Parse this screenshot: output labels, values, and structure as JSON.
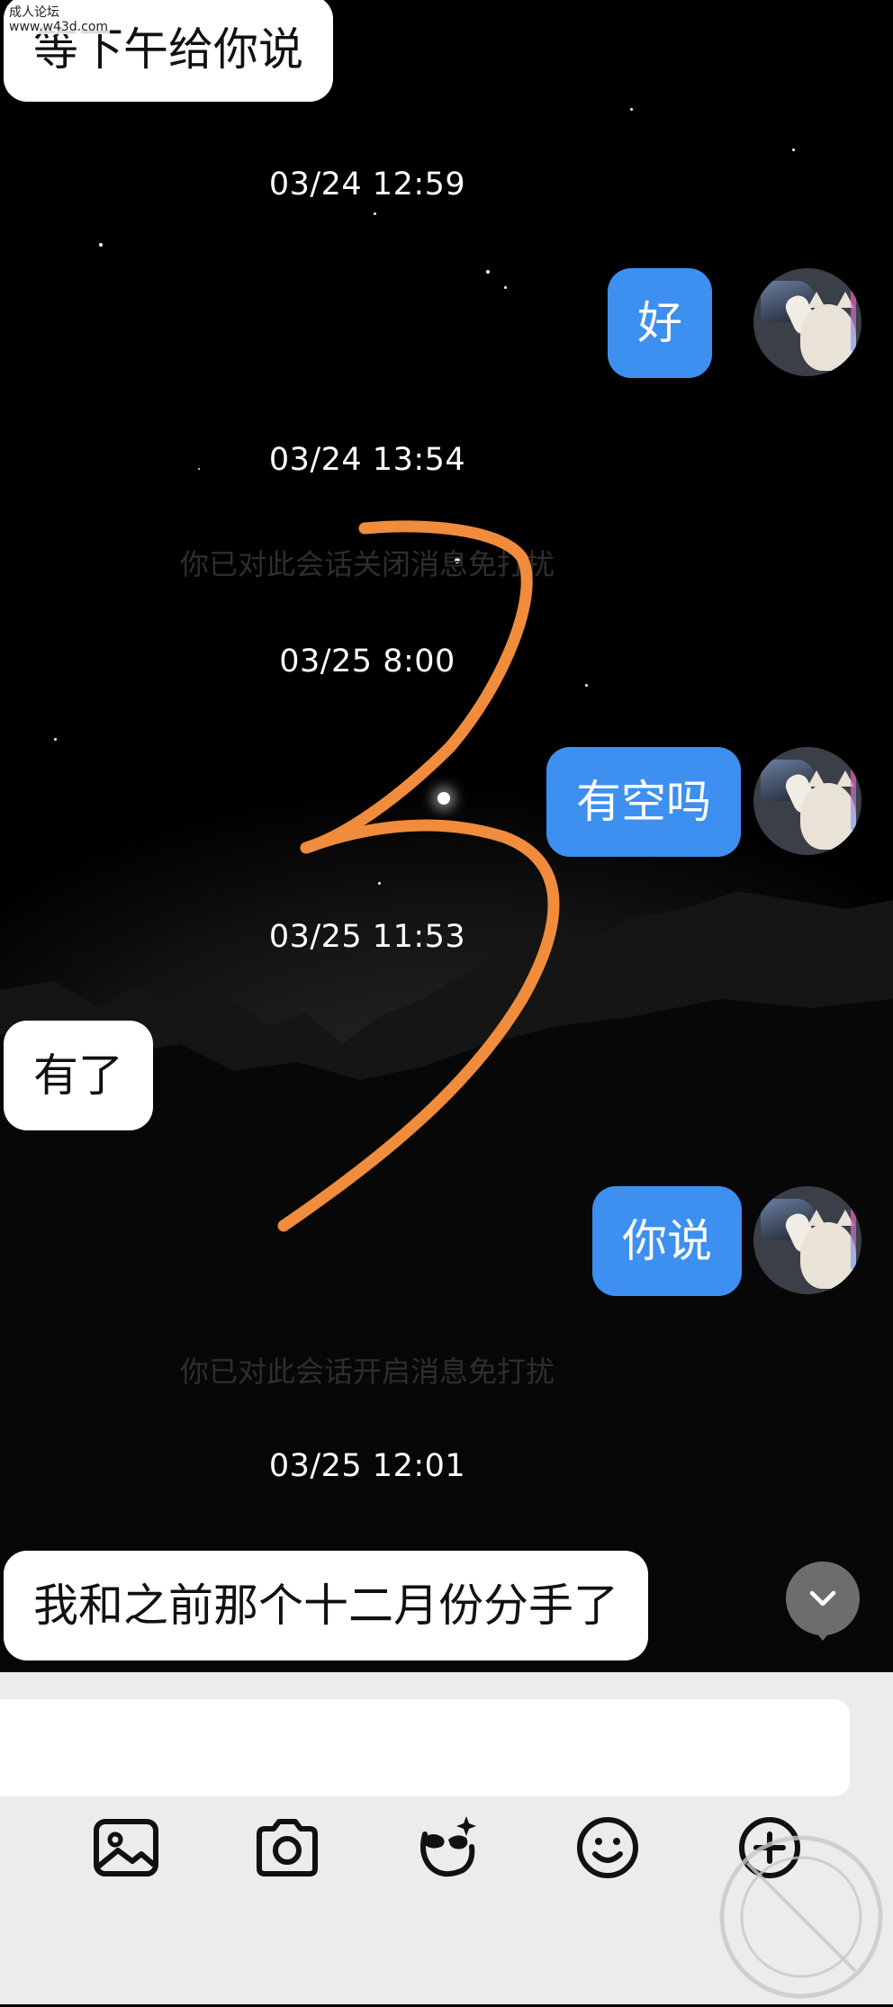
{
  "watermark": {
    "line1": "成人论坛",
    "line2": "www.w43d.com"
  },
  "messages": [
    {
      "text": "等下午给你说"
    },
    {
      "text": "03/24 12:59"
    },
    {
      "text": "好"
    },
    {
      "text": "03/24 13:54"
    },
    {
      "text": "你已对此会话关闭消息免打扰"
    },
    {
      "text": "03/25 8:00"
    },
    {
      "text": "有空吗"
    },
    {
      "text": "03/25 11:53"
    },
    {
      "text": "有了"
    },
    {
      "text": "你说"
    },
    {
      "text": "你已对此会话开启消息免打扰"
    },
    {
      "text": "03/25 12:01"
    },
    {
      "text": "我和之前那个十二月份分手了"
    }
  ],
  "composer": {
    "input_value": "",
    "tools": [
      "image-icon",
      "camera-icon",
      "sticker-mask-icon",
      "emoji-icon",
      "add-icon"
    ]
  },
  "scroll_to_latest": {
    "icon": "chevron-down-icon"
  },
  "colors": {
    "outgoing_bubble": "#3d8ff0",
    "incoming_bubble": "#ffffff",
    "scribble": "#f08c3c",
    "composer_bg": "#ececec"
  }
}
